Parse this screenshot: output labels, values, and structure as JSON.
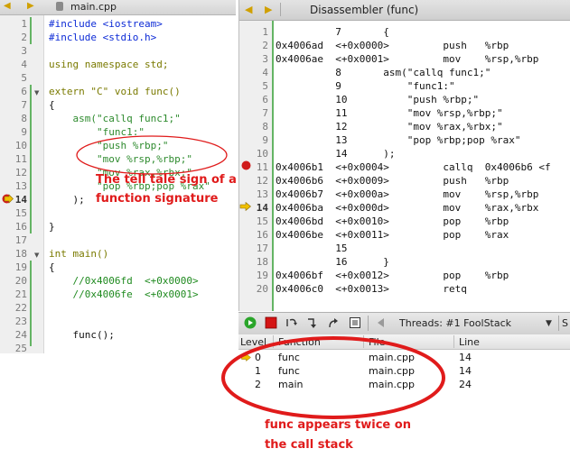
{
  "colors": {
    "annotation": "#e01b1b",
    "code_keyword": "#7a7a00",
    "code_string": "#2e8b2e",
    "code_default": "#0d2bd6",
    "change_bar": "#64b464"
  },
  "source_editor": {
    "tab_title": "main.cpp",
    "lines": [
      {
        "num": "1",
        "text": "#include <iostream>"
      },
      {
        "num": "2",
        "text": "#include <stdio.h>"
      },
      {
        "num": "3",
        "text": ""
      },
      {
        "num": "4",
        "text": "using namespace std;"
      },
      {
        "num": "5",
        "text": ""
      },
      {
        "num": "6",
        "text": "extern \"C\" void func()"
      },
      {
        "num": "7",
        "text": "{"
      },
      {
        "num": "8",
        "text": "    asm(\"callq func1;\""
      },
      {
        "num": "9",
        "text": "        \"func1:\""
      },
      {
        "num": "10",
        "text": "        \"push %rbp;\""
      },
      {
        "num": "11",
        "text": "        \"mov %rsp,%rbp;\""
      },
      {
        "num": "12",
        "text": "        \"mov %rax,%rbx;\""
      },
      {
        "num": "13",
        "text": "        \"pop %rbp;pop %rax\""
      },
      {
        "num": "14",
        "text": "    );"
      },
      {
        "num": "15",
        "text": ""
      },
      {
        "num": "16",
        "text": "}"
      },
      {
        "num": "17",
        "text": ""
      },
      {
        "num": "18",
        "text": "int main()"
      },
      {
        "num": "19",
        "text": "{"
      },
      {
        "num": "20",
        "text": "    //0x4006fd  <+0x0000>"
      },
      {
        "num": "21",
        "text": "    //0x4006fe  <+0x0001>"
      },
      {
        "num": "22",
        "text": ""
      },
      {
        "num": "23",
        "text": ""
      },
      {
        "num": "24",
        "text": "    func();"
      },
      {
        "num": "25",
        "text": ""
      }
    ]
  },
  "disassembler": {
    "tab_title": "Disassembler (func)",
    "lines": [
      {
        "num": "1",
        "text": "          7       {"
      },
      {
        "num": "2",
        "text": "0x4006ad  <+0x0000>         push   %rbp"
      },
      {
        "num": "3",
        "text": "0x4006ae  <+0x0001>         mov    %rsp,%rbp"
      },
      {
        "num": "4",
        "text": "          8       asm(\"callq func1;\""
      },
      {
        "num": "5",
        "text": "          9           \"func1:\""
      },
      {
        "num": "6",
        "text": "          10          \"push %rbp;\""
      },
      {
        "num": "7",
        "text": "          11          \"mov %rsp,%rbp;\""
      },
      {
        "num": "8",
        "text": "          12          \"mov %rax,%rbx;\""
      },
      {
        "num": "9",
        "text": "          13          \"pop %rbp;pop %rax\""
      },
      {
        "num": "10",
        "text": "          14      );"
      },
      {
        "num": "11",
        "text": "0x4006b1  <+0x0004>         callq  0x4006b6 <f"
      },
      {
        "num": "12",
        "text": "0x4006b6  <+0x0009>         push   %rbp"
      },
      {
        "num": "13",
        "text": "0x4006b7  <+0x000a>         mov    %rsp,%rbp"
      },
      {
        "num": "14",
        "text": "0x4006ba  <+0x000d>         mov    %rax,%rbx"
      },
      {
        "num": "15",
        "text": "0x4006bd  <+0x0010>         pop    %rbp"
      },
      {
        "num": "16",
        "text": "0x4006be  <+0x0011>         pop    %rax"
      },
      {
        "num": "17",
        "text": "          15"
      },
      {
        "num": "18",
        "text": "          16      }"
      },
      {
        "num": "19",
        "text": "0x4006bf  <+0x0012>         pop    %rbp"
      },
      {
        "num": "20",
        "text": "0x4006c0  <+0x0013>         retq"
      }
    ]
  },
  "debug_toolbar": {
    "threads_label": "Threads:",
    "thread_value": "#1 FoolStack",
    "trailing": "S"
  },
  "call_stack": {
    "columns": [
      "Level",
      "Function",
      "File",
      "Line"
    ],
    "rows": [
      {
        "level": "0",
        "function": "func",
        "file": "main.cpp",
        "line": "14"
      },
      {
        "level": "1",
        "function": "func",
        "file": "main.cpp",
        "line": "14"
      },
      {
        "level": "2",
        "function": "main",
        "file": "main.cpp",
        "line": "24"
      }
    ]
  },
  "annotations": {
    "signature_note_1": "The tell tale sign of a",
    "signature_note_2": "function signature",
    "stack_note_1": "func appears twice on",
    "stack_note_2": "the call stack"
  }
}
